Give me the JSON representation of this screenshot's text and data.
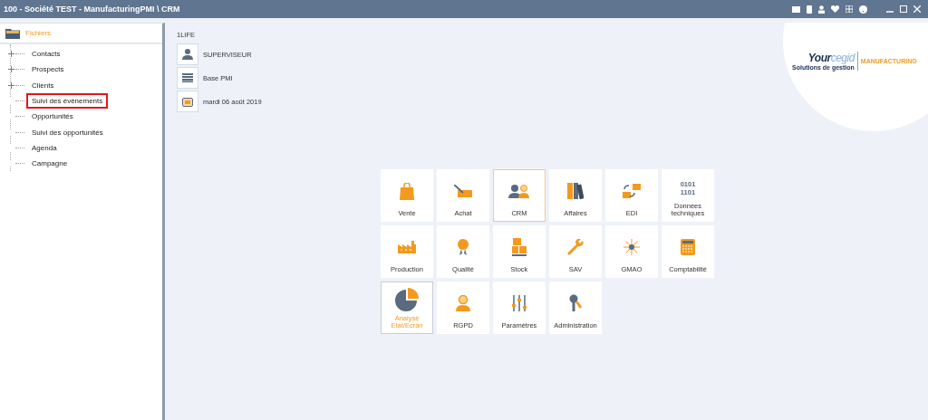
{
  "window": {
    "title": "100 - Société TEST - ManufacturingPMI \\ CRM"
  },
  "sidebar": {
    "root": "Fichiers",
    "items": [
      {
        "label": "Contacts",
        "expandable": true,
        "highlighted": false
      },
      {
        "label": "Prospects",
        "expandable": true,
        "highlighted": false
      },
      {
        "label": "Clients",
        "expandable": true,
        "highlighted": false
      },
      {
        "label": "Suivi des évènements",
        "expandable": false,
        "highlighted": true
      },
      {
        "label": "Opportunités",
        "expandable": false,
        "highlighted": false
      },
      {
        "label": "Suivi des opportunités",
        "expandable": false,
        "highlighted": false
      },
      {
        "label": "Agenda",
        "expandable": false,
        "highlighted": false
      },
      {
        "label": "Campagne",
        "expandable": false,
        "highlighted": false
      }
    ]
  },
  "session": {
    "company": "1LIFE",
    "user": "SUPERVISEUR",
    "database": "Base PMI",
    "date": "mardi 06 août 2019"
  },
  "logo": {
    "brand_dark": "Your",
    "brand_light": "cegid",
    "tagline": "Solutions de gestion",
    "product": "MANUFACTURING"
  },
  "modules": [
    {
      "label": "Vente",
      "selected": false,
      "focused": false
    },
    {
      "label": "Achat",
      "selected": false,
      "focused": false
    },
    {
      "label": "CRM",
      "selected": true,
      "focused": false
    },
    {
      "label": "Affaires",
      "selected": false,
      "focused": false
    },
    {
      "label": "EDI",
      "selected": false,
      "focused": false
    },
    {
      "label": "Données techniques",
      "selected": false,
      "focused": false,
      "icon_text": [
        "0101",
        "1101"
      ]
    },
    {
      "label": "Production",
      "selected": false,
      "focused": false
    },
    {
      "label": "Qualité",
      "selected": false,
      "focused": false
    },
    {
      "label": "Stock",
      "selected": false,
      "focused": false
    },
    {
      "label": "SAV",
      "selected": false,
      "focused": false
    },
    {
      "label": "GMAO",
      "selected": false,
      "focused": false
    },
    {
      "label": "Comptabilité",
      "selected": false,
      "focused": false
    },
    {
      "label": "Analyse Etat/Ecran",
      "selected": false,
      "focused": true
    },
    {
      "label": "RGPD",
      "selected": false,
      "focused": false
    },
    {
      "label": "Paramètres",
      "selected": false,
      "focused": false
    },
    {
      "label": "Administration",
      "selected": false,
      "focused": false
    }
  ]
}
